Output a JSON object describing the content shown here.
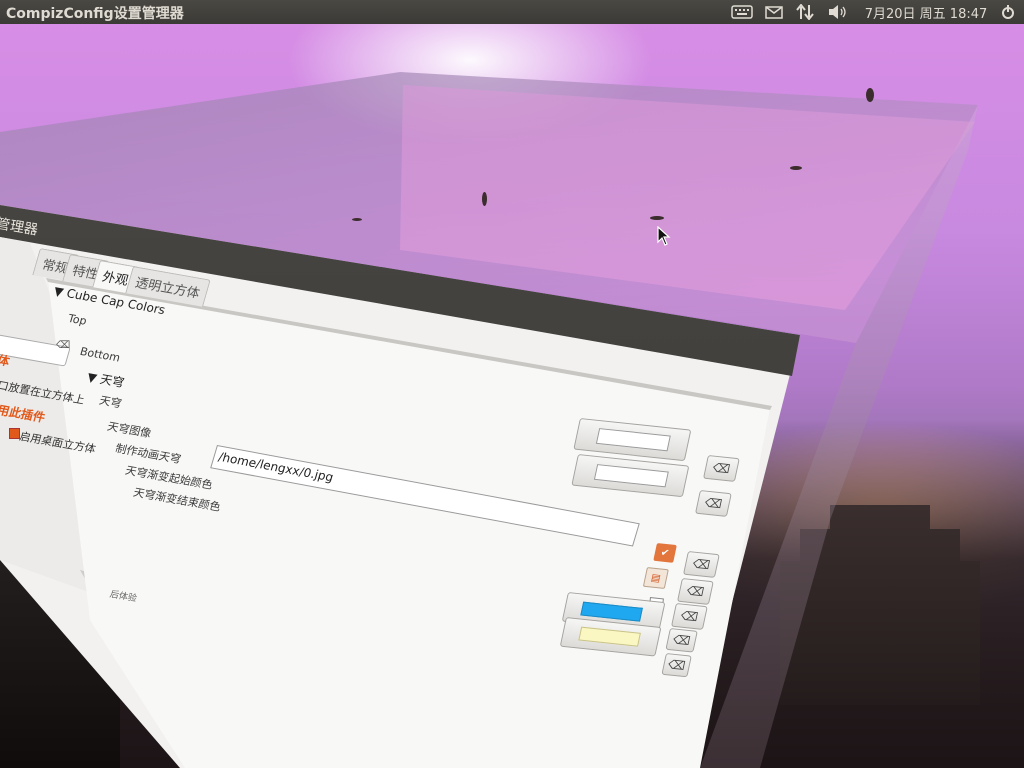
{
  "panel": {
    "window_title": "CompizConfig设置管理器",
    "clock": "7月20日 周五 18:47",
    "icons": {
      "keyboard": "keyboard-icon",
      "mail": "mail-icon",
      "network": "network-icon",
      "sound": "sound-icon",
      "session": "gear-icon"
    }
  },
  "window": {
    "title_fragment": "管理器",
    "sidebar": {
      "category": "体",
      "item_place": "口放置在立方体上",
      "category_plugins": "用此插件",
      "check_item": "启用桌面立方体",
      "footer": "后体验"
    },
    "tabs": [
      {
        "label": "常规"
      },
      {
        "label": "特性"
      },
      {
        "label": "外观"
      },
      {
        "label": "透明立方体"
      }
    ],
    "sections": {
      "cube_caps": "▼ Cube Cap Colors",
      "top": "Top",
      "bottom": "Bottom",
      "skydome_section": "▼ 天穹",
      "skydome": "天穹",
      "skydome_image": "天穹图像",
      "animate_skydome": "制作动画天穹",
      "gradient_start": "天穹渐变起始颜色",
      "gradient_end": "天穹渐变结束颜色"
    },
    "path_value": "/home/lengxx/0.jpg",
    "colors": {
      "gradient_start": "#1fa8f0",
      "gradient_end": "#fbf7c2",
      "top_cap": "#ffffff",
      "bottom_cap": "#ffffff",
      "accent": "#e1581b"
    }
  }
}
